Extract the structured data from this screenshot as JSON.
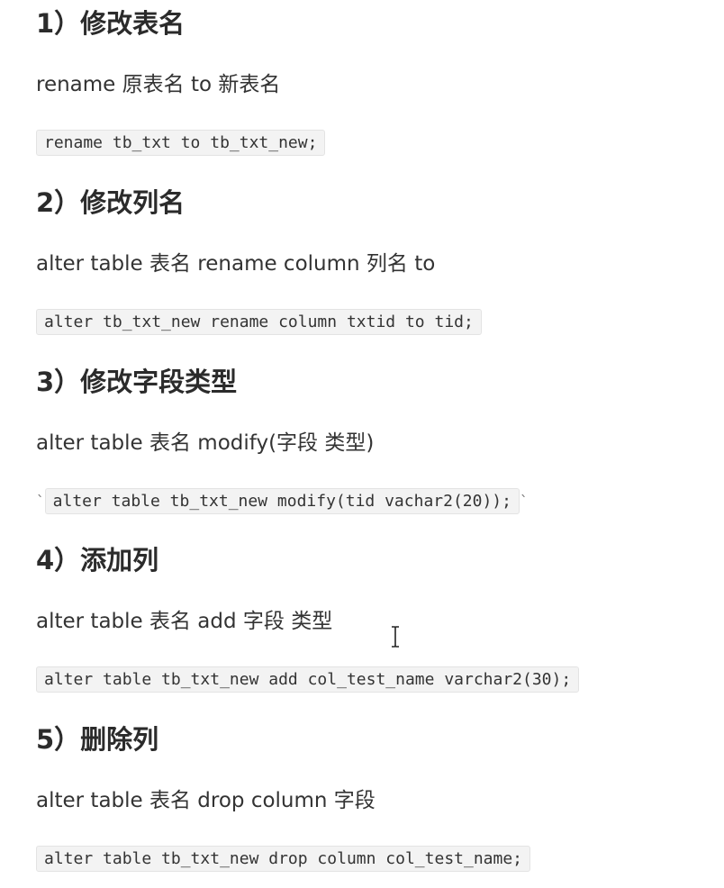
{
  "sections": [
    {
      "heading": "1）修改表名",
      "syntax": "rename 原表名 to 新表名",
      "code": "rename tb_txt to tb_txt_new;"
    },
    {
      "heading": "2）修改列名",
      "syntax": "alter table 表名 rename column 列名 to",
      "code": "alter tb_txt_new rename column txtid to tid;"
    },
    {
      "heading": "3）修改字段类型",
      "syntax": "alter table 表名 modify(字段 类型)",
      "code": "alter table tb_txt_new modify(tid vachar2(20));",
      "tick_before": "`",
      "tick_after": "`"
    },
    {
      "heading": "4）添加列",
      "syntax": "alter table 表名 add 字段 类型",
      "code": "alter table tb_txt_new add col_test_name varchar2(30);"
    },
    {
      "heading": "5）删除列",
      "syntax": "alter table 表名 drop column 字段",
      "code": "alter table tb_txt_new drop column col_test_name;"
    }
  ],
  "cursor": {
    "icon": "text-cursor-icon"
  }
}
